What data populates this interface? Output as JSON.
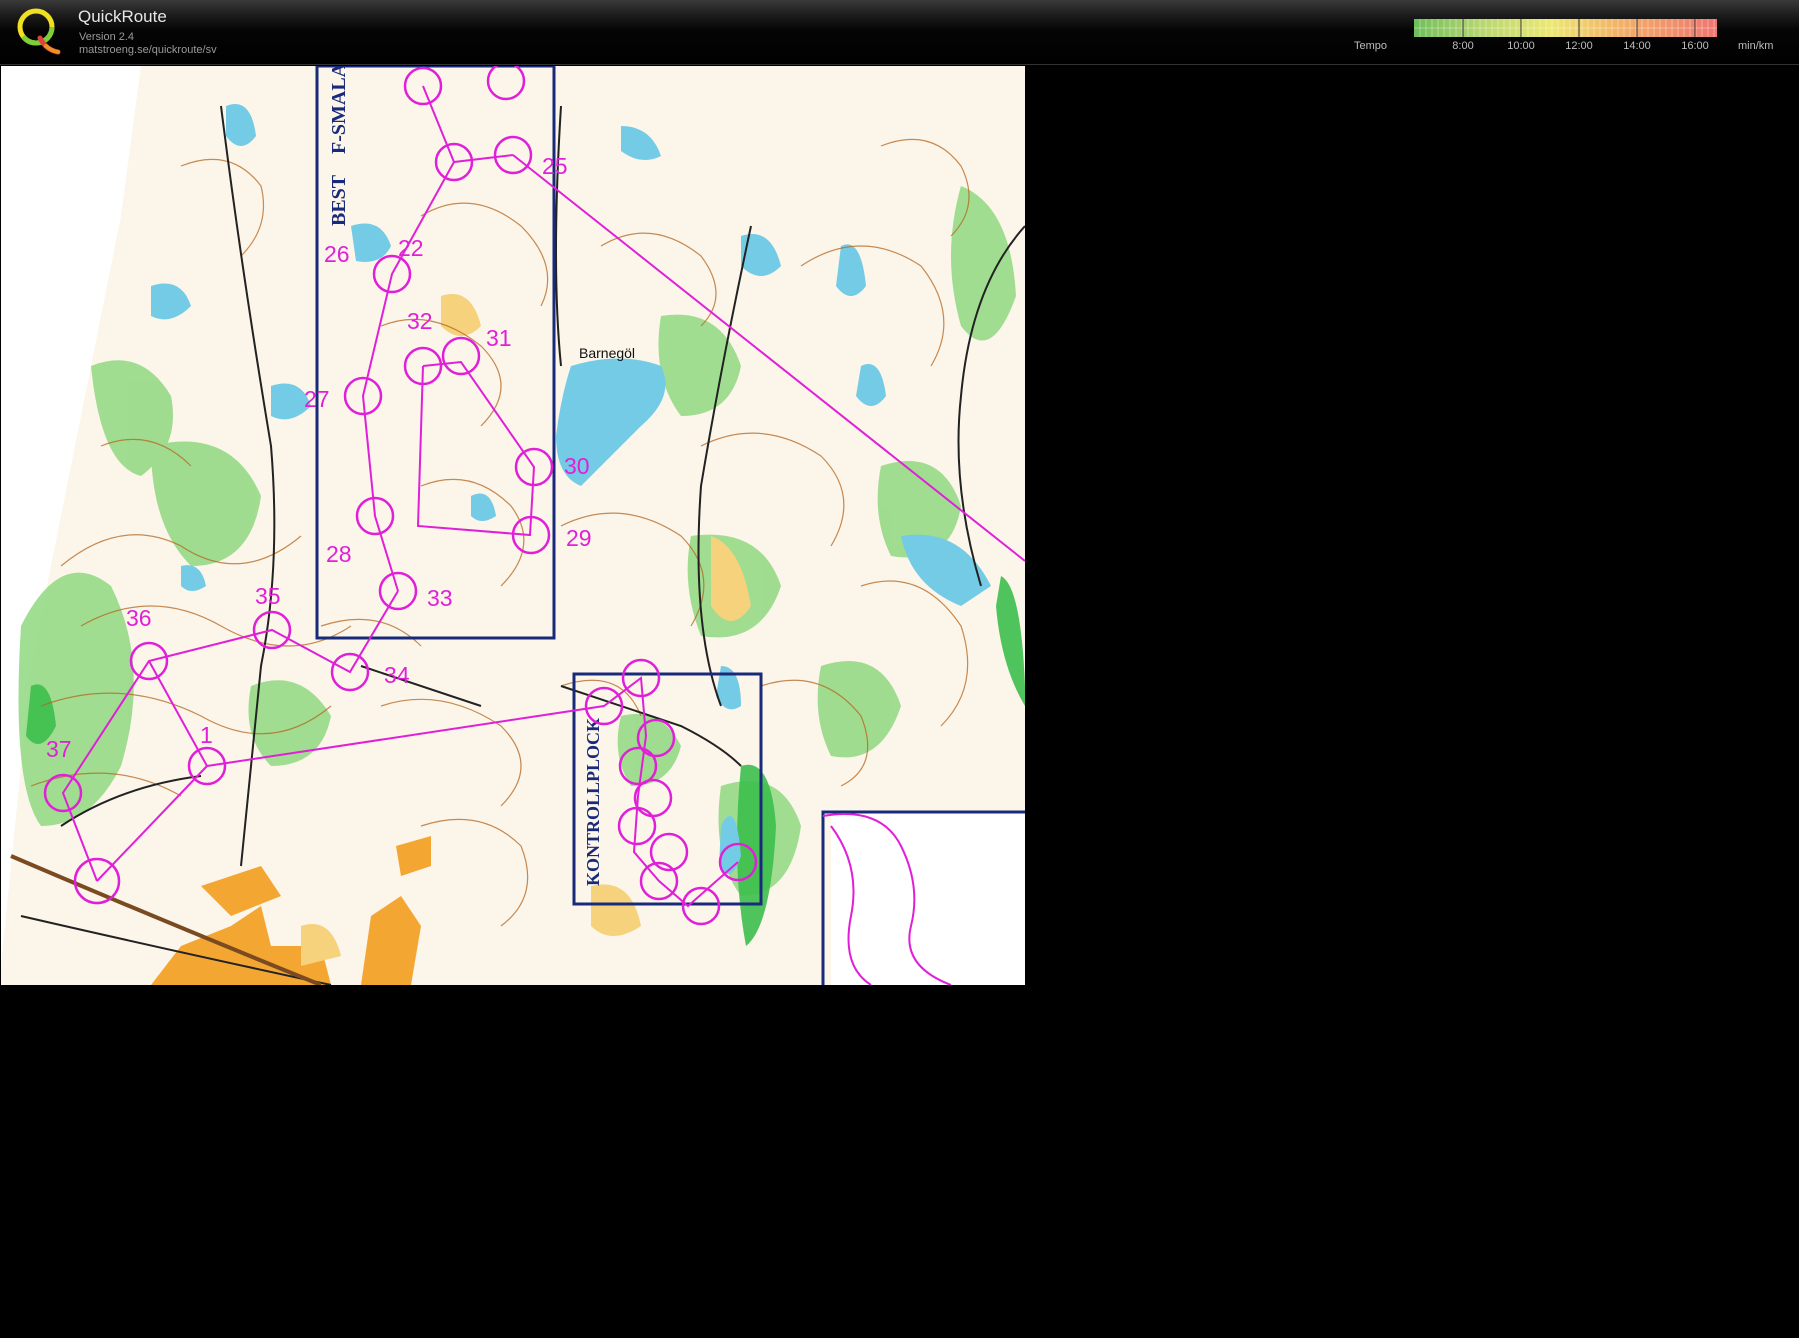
{
  "header": {
    "app_title": "QuickRoute",
    "version": "Version 2.4",
    "url": "matstroeng.se/quickroute/sv"
  },
  "tempo_scale": {
    "label": "Tempo",
    "unit": "min/km",
    "ticks": [
      "8:00",
      "10:00",
      "12:00",
      "14:00",
      "16:00"
    ],
    "colors": [
      "#6fbf5a",
      "#b7d670",
      "#ece872",
      "#f3b166",
      "#ef7570"
    ]
  },
  "map": {
    "lake_name": "Barnegöl",
    "box_labels": [
      "BEST",
      "F-SMALA",
      "KONTROLLPLOCK"
    ],
    "course_color": "#e020d8",
    "frame_color": "#1a2a7a",
    "controls": [
      {
        "label": "1"
      },
      {
        "label": "22"
      },
      {
        "label": "25"
      },
      {
        "label": "26"
      },
      {
        "label": "27"
      },
      {
        "label": "28"
      },
      {
        "label": "29"
      },
      {
        "label": "30"
      },
      {
        "label": "31"
      },
      {
        "label": "32"
      },
      {
        "label": "33"
      },
      {
        "label": "34"
      },
      {
        "label": "35"
      },
      {
        "label": "36"
      },
      {
        "label": "37"
      }
    ]
  }
}
